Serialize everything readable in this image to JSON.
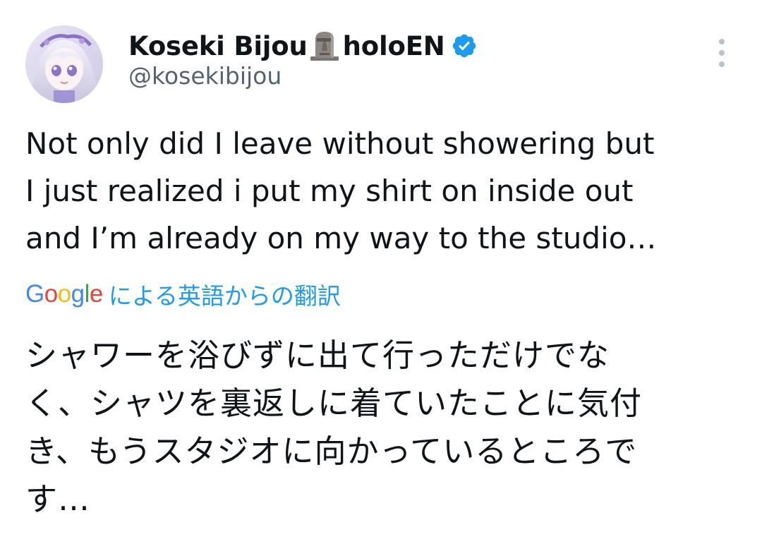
{
  "author": {
    "display_name": "Koseki Bijou",
    "name_emoji": "moai-icon",
    "name_suffix": "holoEN",
    "handle": "@kosekibijou",
    "verified": true,
    "verified_color": "#1d9bf0",
    "avatar": "avatar-image"
  },
  "menu": {
    "icon": "more-vertical-icon"
  },
  "tweet": {
    "text_lines": [
      "Not only did I leave without showering but",
      "I just realized i put my shirt on inside out",
      "and I’m already on my way to the studio…"
    ]
  },
  "translation": {
    "provider_logo_text": [
      "G",
      "o",
      "o",
      "g",
      "l",
      "e"
    ],
    "provider_logo_colors": [
      "#4285F4",
      "#EA4335",
      "#FBBC05",
      "#4285F4",
      "#34A853",
      "#EA4335"
    ],
    "label": "による英語からの翻訳",
    "label_color": "#1d9bf0",
    "text_lines": [
      "シャワーを浴びずに出て行っただけでな",
      "く、シャツを裏返しに着ていたことに気付",
      "き、もうスタジオに向かっているところで",
      "す…"
    ]
  },
  "colors": {
    "text_primary": "#0f1419",
    "text_secondary": "#536471",
    "background": "#ffffff"
  }
}
